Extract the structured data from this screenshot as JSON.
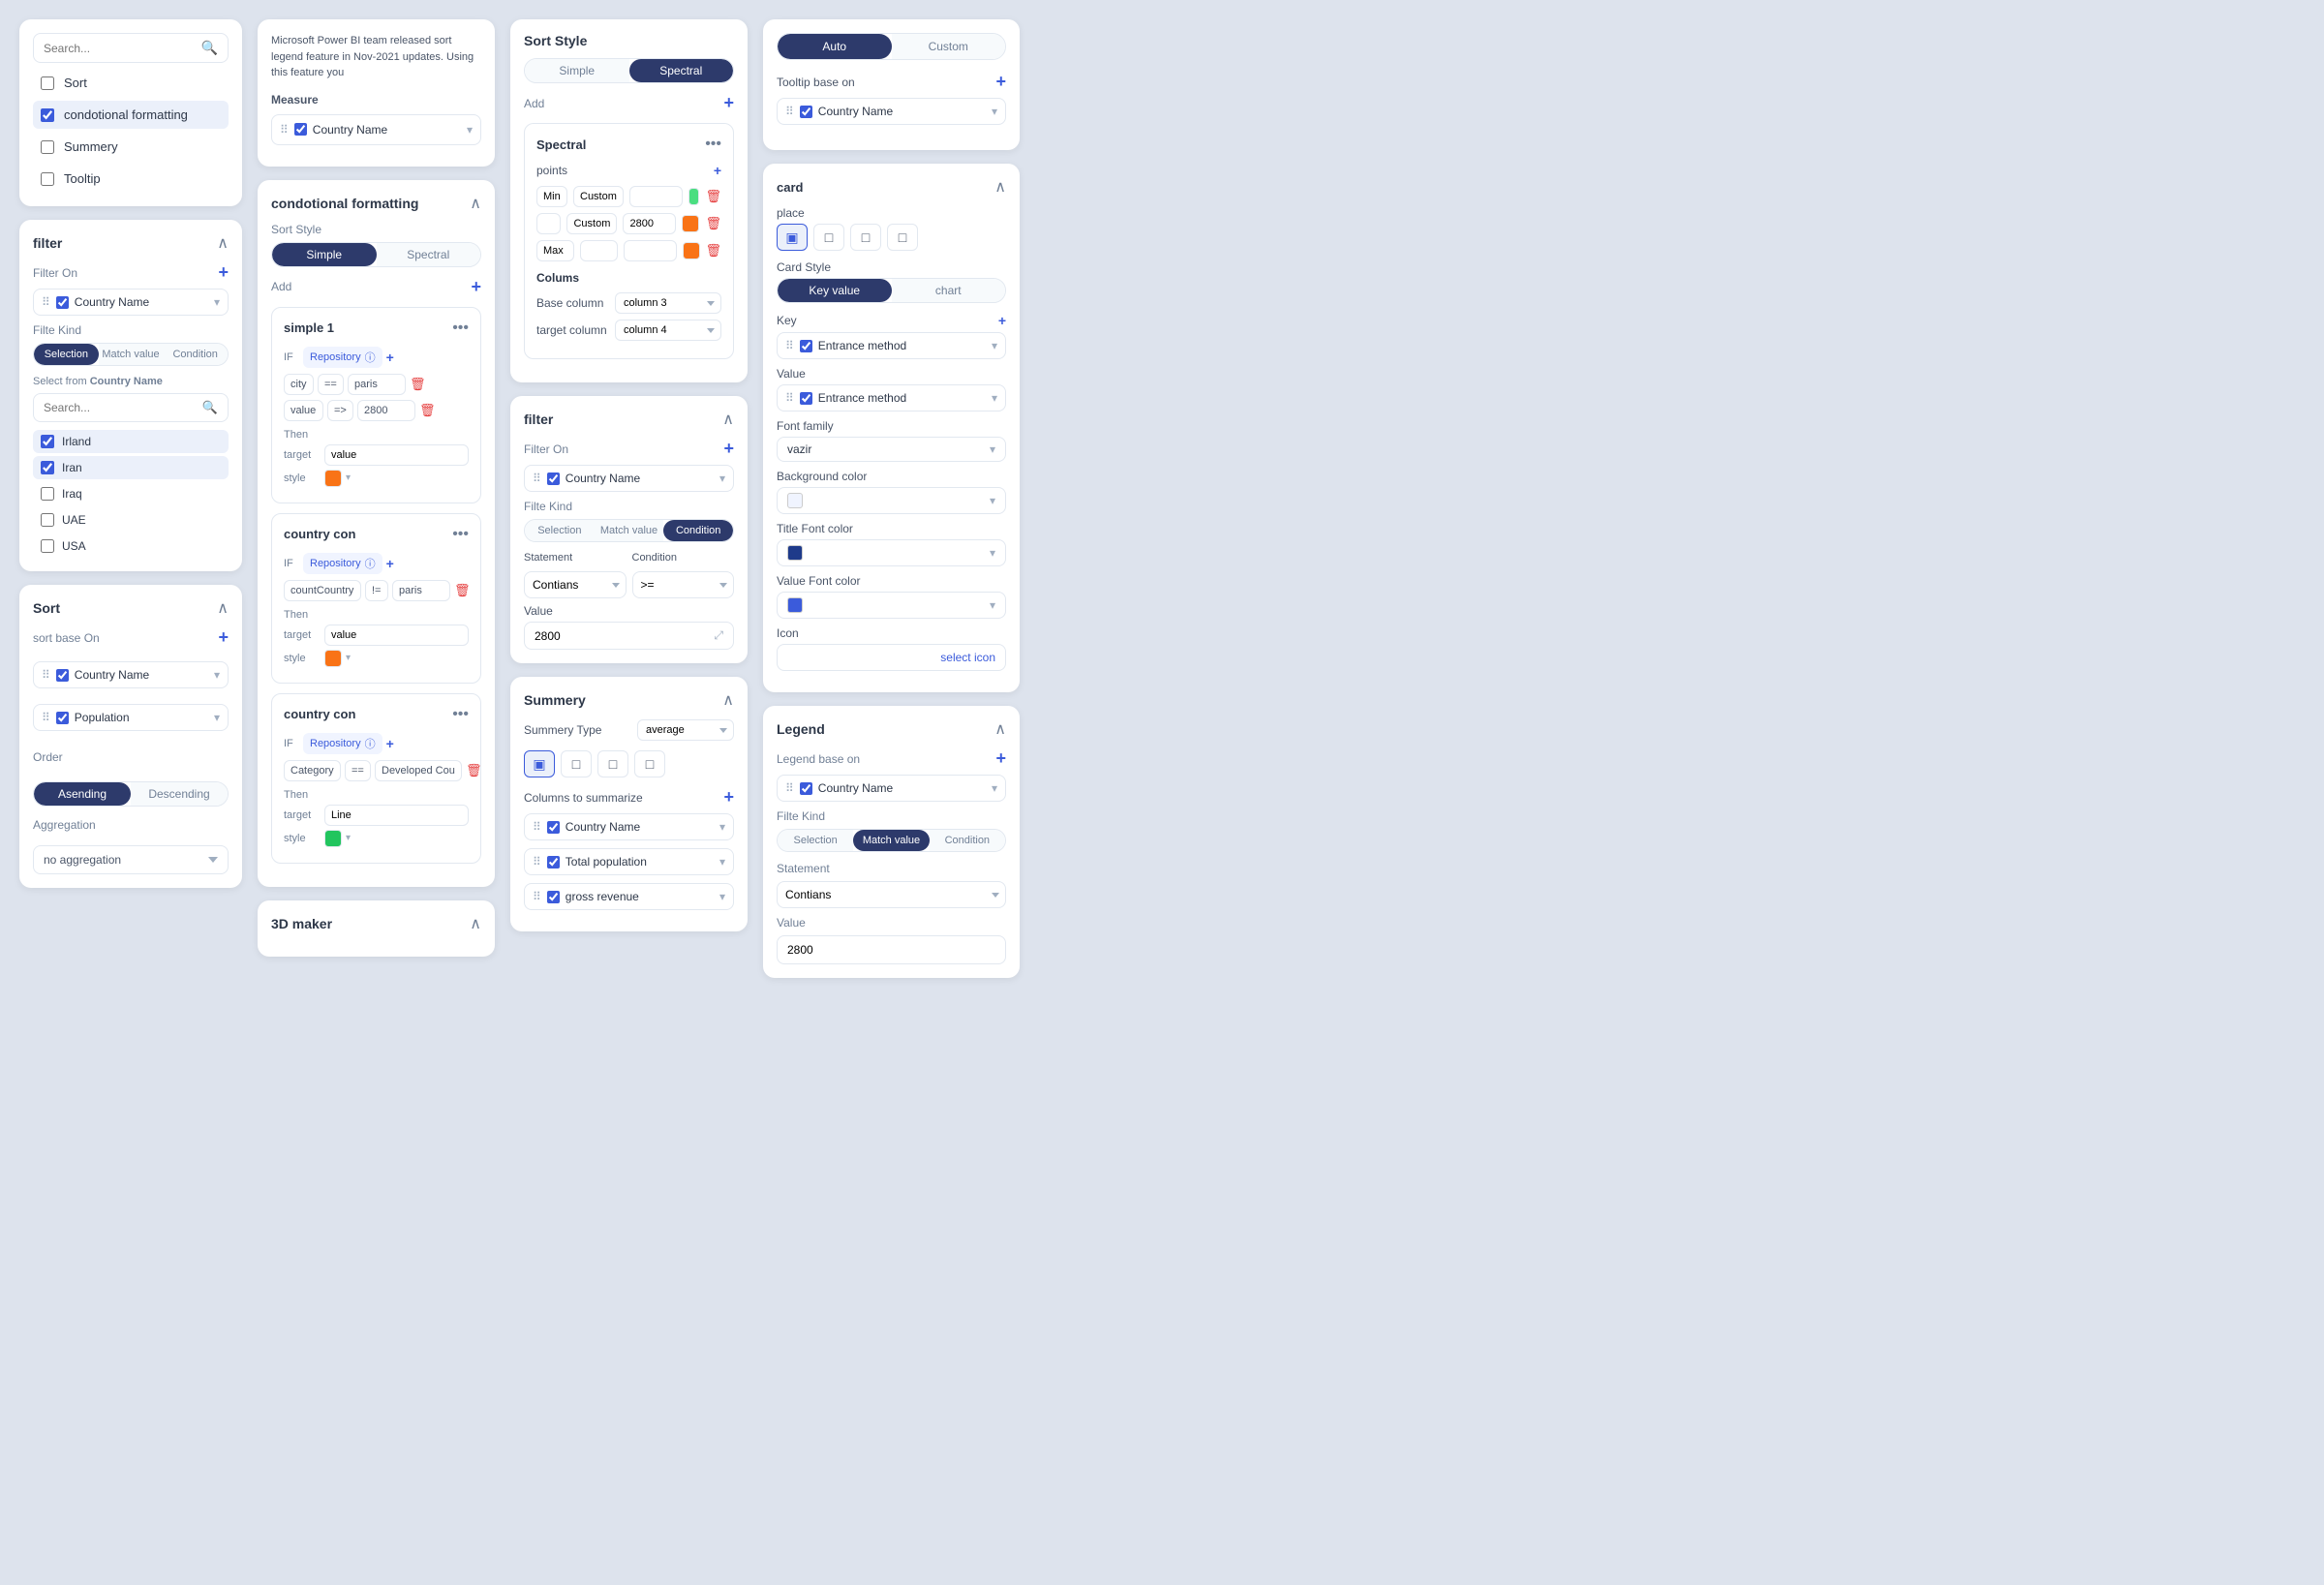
{
  "col1": {
    "search_placeholder": "Search...",
    "menu_items": [
      {
        "id": "sort",
        "label": "Sort",
        "checked": false
      },
      {
        "id": "cond_fmt",
        "label": "condotional formatting",
        "checked": true
      },
      {
        "id": "summery",
        "label": "Summery",
        "checked": false
      },
      {
        "id": "tooltip",
        "label": "Tooltip",
        "checked": false
      }
    ],
    "filter": {
      "title": "filter",
      "filter_on_label": "Filter On",
      "field": "Country Name",
      "filte_kind_label": "Filte Kind",
      "kinds": [
        "Selection",
        "Match value",
        "Condition"
      ],
      "active_kind": "Selection",
      "select_from_label": "Select from",
      "select_from_field": "Country Name",
      "countries": [
        {
          "name": "Irland",
          "checked": true
        },
        {
          "name": "Iran",
          "checked": true
        },
        {
          "name": "Iraq",
          "checked": false
        },
        {
          "name": "UAE",
          "checked": false
        },
        {
          "name": "USA",
          "checked": false
        }
      ]
    },
    "sort": {
      "title": "Sort",
      "sort_base_label": "sort base On",
      "fields": [
        {
          "name": "Country Name"
        },
        {
          "name": "Population"
        }
      ],
      "order_label": "Order",
      "orders": [
        "Asending",
        "Descending"
      ],
      "active_order": "Asending",
      "aggregation_label": "Aggregation",
      "aggregation_value": "no aggregation"
    }
  },
  "col2": {
    "info_text": "Microsoft Power BI team released sort legend feature in Nov-2021 updates. Using this feature you",
    "measure_label": "Measure",
    "measure_field": "Country Name",
    "cond_fmt": {
      "title": "condotional formatting",
      "sort_style_label": "Sort Style",
      "styles": [
        "Simple",
        "Spectral"
      ],
      "active_style": "Simple",
      "add_label": "Add",
      "blocks": [
        {
          "title": "simple 1",
          "if_label": "IF",
          "repo_label": "Repository",
          "condition_field": "city",
          "operator": "==",
          "operator2": "=>",
          "value": "paris",
          "value2": "2800",
          "then_label": "Then",
          "target_label": "target",
          "target_value": "value",
          "style_label": "style",
          "style_color": "#f97316"
        },
        {
          "title": "country con",
          "if_label": "IF",
          "repo_label": "Repository",
          "condition_field": "countCountry",
          "operator": "!=",
          "value": "paris",
          "then_label": "Then",
          "target_label": "target",
          "target_value": "value",
          "style_label": "style",
          "style_color": "#f97316"
        },
        {
          "title": "country con",
          "if_label": "IF",
          "repo_label": "Repository",
          "condition_field": "Category",
          "operator": "==",
          "value": "Developed Countr",
          "then_label": "Then",
          "target_label": "target",
          "target_value": "Line",
          "style_label": "style",
          "style_color": "#22c55e"
        }
      ]
    },
    "maker_3d": {
      "title": "3D maker"
    }
  },
  "col3": {
    "sort_style": {
      "title": "Sort Style",
      "styles": [
        "Simple",
        "Spectral"
      ],
      "active_style": "Spectral",
      "add_label": "Add",
      "spectral": {
        "title": "Spectral",
        "points_label": "points",
        "rows": [
          {
            "label": "Min",
            "custom_label": "Custom",
            "value": "",
            "color": "#4ade80"
          },
          {
            "label": "",
            "custom_label": "Custom",
            "value": "2800",
            "color": "#f97316"
          },
          {
            "label": "Max",
            "custom_label": "",
            "value": "",
            "color": "#f97316"
          }
        ],
        "columns": {
          "title": "Colums",
          "base_column_label": "Base column",
          "base_column_value": "column 3",
          "target_column_label": "target column",
          "target_column_value": "column 4"
        }
      }
    },
    "filter": {
      "title": "filter",
      "filter_on_label": "Filter On",
      "field": "Country Name",
      "filte_kind_label": "Filte Kind",
      "kinds": [
        "Selection",
        "Match value",
        "Condition"
      ],
      "active_kind": "Condition",
      "statement_label": "Statement",
      "condition_label": "Condition",
      "statement_value": "Contians",
      "condition_value": ">=",
      "value_label": "Value",
      "value": "2800"
    },
    "summery": {
      "title": "Summery",
      "summery_type_label": "Summery Type",
      "summery_type_value": "average",
      "place_icons": [
        "▣",
        "□",
        "□",
        "□"
      ],
      "columns_label": "Columns to summarize",
      "fields": [
        {
          "name": "Country Name"
        },
        {
          "name": "Total population"
        },
        {
          "name": "gross revenue"
        }
      ]
    }
  },
  "col4": {
    "auto_custom": {
      "options": [
        "Auto",
        "Custom"
      ],
      "active": "Auto"
    },
    "tooltip": {
      "title": "Tooltip base on",
      "field": "Country Name"
    },
    "card": {
      "title": "card",
      "place_label": "place",
      "place_icons": [
        "▣",
        "□",
        "□",
        "□"
      ],
      "card_style_label": "Card Style",
      "card_styles": [
        "Key value",
        "chart"
      ],
      "active_style": "Key value",
      "key_label": "Key",
      "key_field": "Entrance method",
      "value_label": "Value",
      "value_field": "Entrance method",
      "font_family_label": "Font family",
      "font_family_value": "vazir",
      "bg_color_label": "Background color",
      "title_font_color_label": "Title Font color",
      "title_font_color": "#1e3a8a",
      "value_font_color_label": "Value Font color",
      "value_font_color": "#3b5bdb",
      "icon_label": "Icon",
      "icon_btn_label": "select icon"
    },
    "legend": {
      "title": "Legend",
      "legend_base_label": "Legend base on",
      "field": "Country Name",
      "filte_kind_label": "Filte Kind",
      "kinds": [
        "Selection",
        "Match value",
        "Condition"
      ],
      "active_kind": "Match value",
      "statement_label": "Statement",
      "statement_value": "Contians",
      "value_label": "Value",
      "value": "2800"
    }
  }
}
